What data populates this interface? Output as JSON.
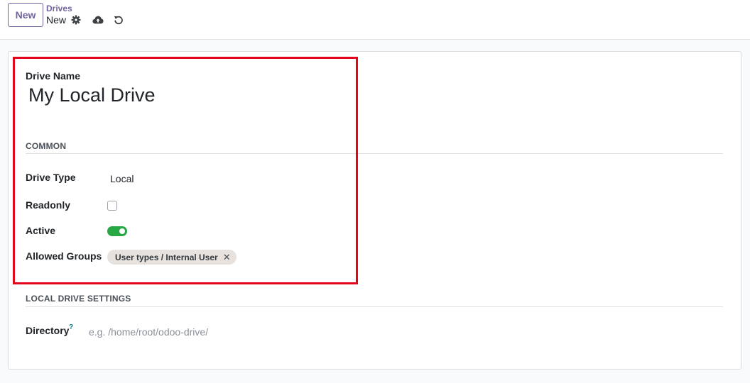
{
  "control_panel": {
    "new_button": "New",
    "breadcrumb_parent": "Drives",
    "breadcrumb_current": "New",
    "icons": [
      "gear-icon",
      "cloud-upload-icon",
      "undo-icon"
    ]
  },
  "form": {
    "drive_name_label": "Drive Name",
    "drive_name_value": "My Local Drive",
    "common_section": "COMMON",
    "drive_type_label": "Drive Type",
    "drive_type_value": "Local",
    "readonly_label": "Readonly",
    "readonly_checked": false,
    "active_label": "Active",
    "active_on": true,
    "allowed_groups_label": "Allowed Groups",
    "allowed_groups": [
      {
        "label": "User types / Internal User"
      }
    ],
    "local_section": "LOCAL DRIVE SETTINGS",
    "directory_label": "Directory",
    "directory_help": "?",
    "directory_value": "",
    "directory_placeholder": "e.g. /home/root/odoo-drive/"
  },
  "colors": {
    "brand": "#71639e",
    "toggle_on": "#28a745",
    "highlight": "#e3061a",
    "tag_bg": "#e7e2dd"
  }
}
